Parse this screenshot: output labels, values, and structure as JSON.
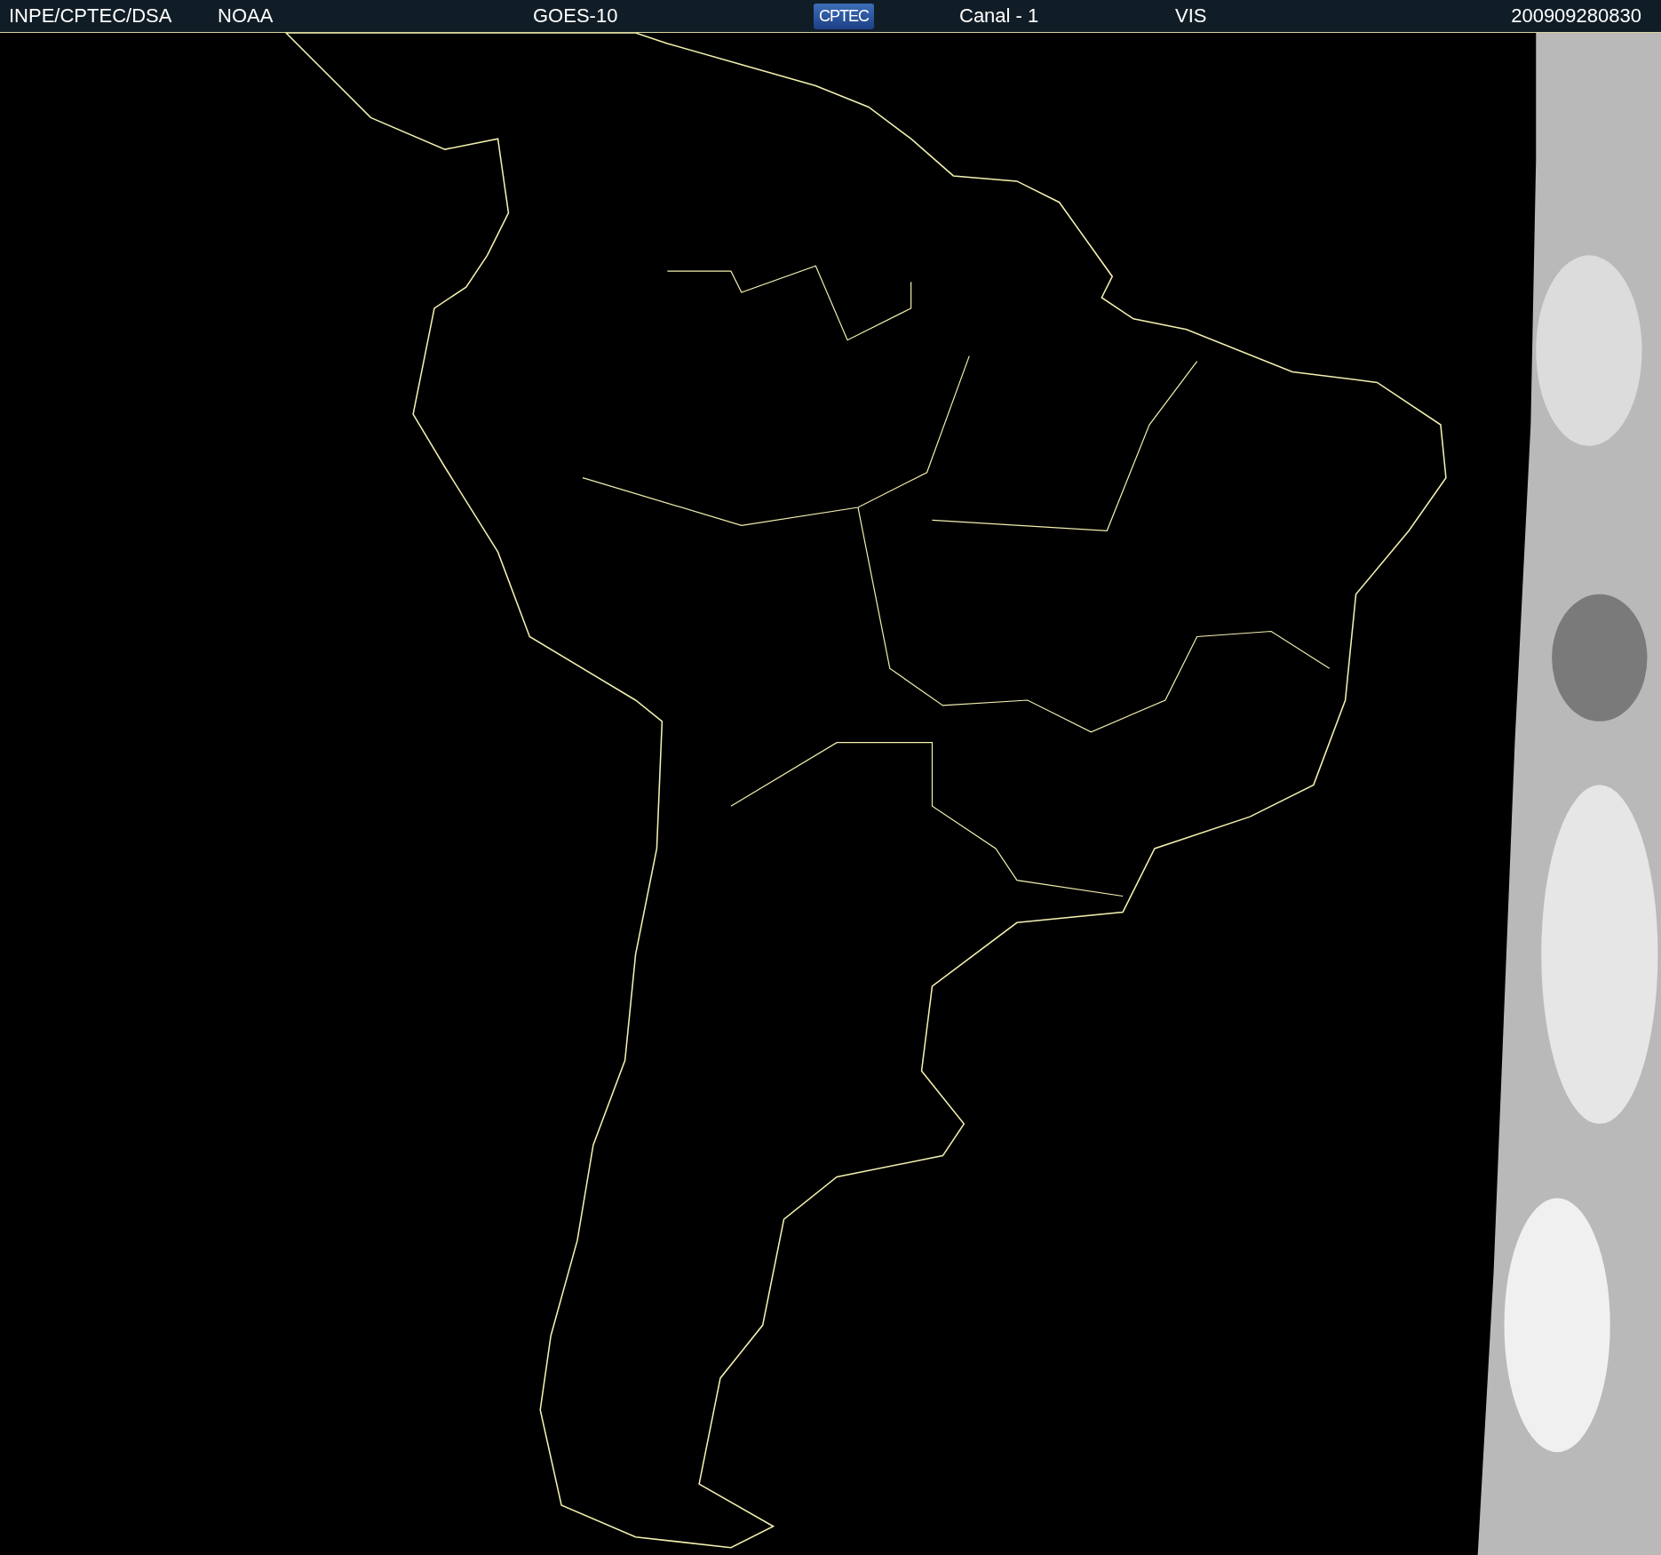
{
  "header": {
    "items": [
      {
        "kind": "text",
        "text": "INPE/CPTEC/DSA"
      },
      {
        "kind": "text",
        "text": "NOAA"
      },
      {
        "kind": "text",
        "text": "GOES-10"
      },
      {
        "kind": "logo",
        "text": "CPTEC"
      },
      {
        "kind": "text",
        "text": "Canal - 1"
      },
      {
        "kind": "text",
        "text": "VIS"
      },
      {
        "kind": "text",
        "text": "200909280830"
      }
    ]
  }
}
